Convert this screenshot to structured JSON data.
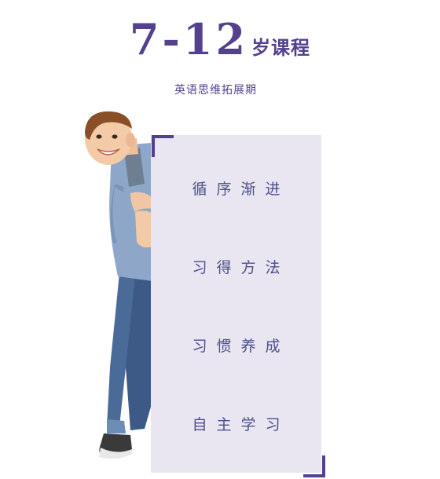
{
  "heading": {
    "age_range": "7-12",
    "suffix": "岁课程"
  },
  "subtitle": "英语思维拓展期",
  "phrases": [
    "循序渐进",
    "习得方法",
    "习惯养成",
    "自主学习"
  ],
  "colors": {
    "brand_purple": "#55408f",
    "panel_bg": "#e9e6f1",
    "phrase_text": "#4d4f8a"
  },
  "image": {
    "subject": "smiling boy peeking from behind panel"
  }
}
